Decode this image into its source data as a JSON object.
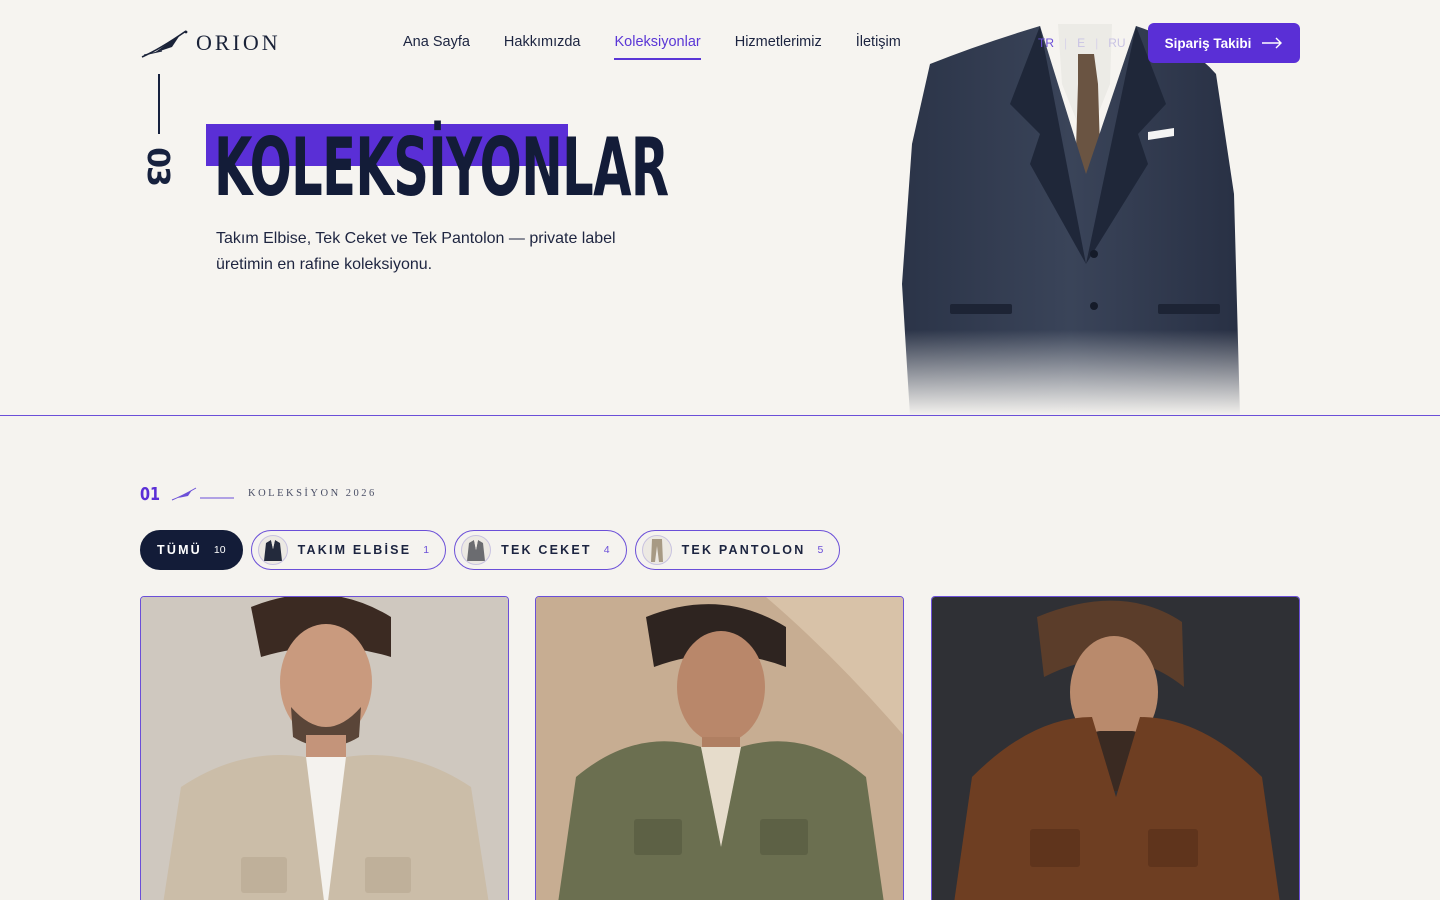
{
  "brand": {
    "name": "ORION"
  },
  "nav": {
    "items": [
      {
        "label": "Ana Sayfa",
        "active": false
      },
      {
        "label": "Hakkımızda",
        "active": false
      },
      {
        "label": "Koleksiyonlar",
        "active": true
      },
      {
        "label": "Hizmetlerimiz",
        "active": false
      },
      {
        "label": "İletişim",
        "active": false
      }
    ]
  },
  "languages": {
    "items": [
      "TR",
      "E",
      "RU"
    ],
    "active": "TR"
  },
  "order_button": {
    "label": "Sipariş Takibi",
    "icon": "arrow-right-icon"
  },
  "hero": {
    "section_number": "03",
    "title": "KOLEKSİYONLAR",
    "description": "Takım Elbise, Tek Ceket ve Tek Pantolon — private label üretimin en rafine koleksiyonu.",
    "image": "navy-suit-jacket"
  },
  "collection": {
    "number": "01",
    "label": "KOLEKSİYON 2026",
    "filters": [
      {
        "label": "TÜMÜ",
        "count": "10",
        "active": true,
        "icon": ""
      },
      {
        "label": "TAKIM ELBİSE",
        "count": "1",
        "active": false,
        "icon": "suit-thumb-icon"
      },
      {
        "label": "TEK CEKET",
        "count": "4",
        "active": false,
        "icon": "jacket-thumb-icon"
      },
      {
        "label": "TEK PANTOLON",
        "count": "5",
        "active": false,
        "icon": "trousers-thumb-icon"
      }
    ],
    "cards": [
      {
        "image": "beige-safari-jacket-model",
        "bg": "#cfc8bf",
        "jacket": "#cbbda8",
        "shirt": "#f4f2ee"
      },
      {
        "image": "olive-field-jacket-model",
        "bg": "#c7ad92",
        "jacket": "#6b6f50",
        "shirt": "#e6dccb"
      },
      {
        "image": "brown-suede-jacket-model",
        "bg": "#2f3035",
        "jacket": "#6e3e22",
        "shirt": "#3a2a22"
      }
    ]
  },
  "colors": {
    "accent": "#5a2fd6",
    "navy": "#131c38",
    "background": "#f5f3ef"
  }
}
